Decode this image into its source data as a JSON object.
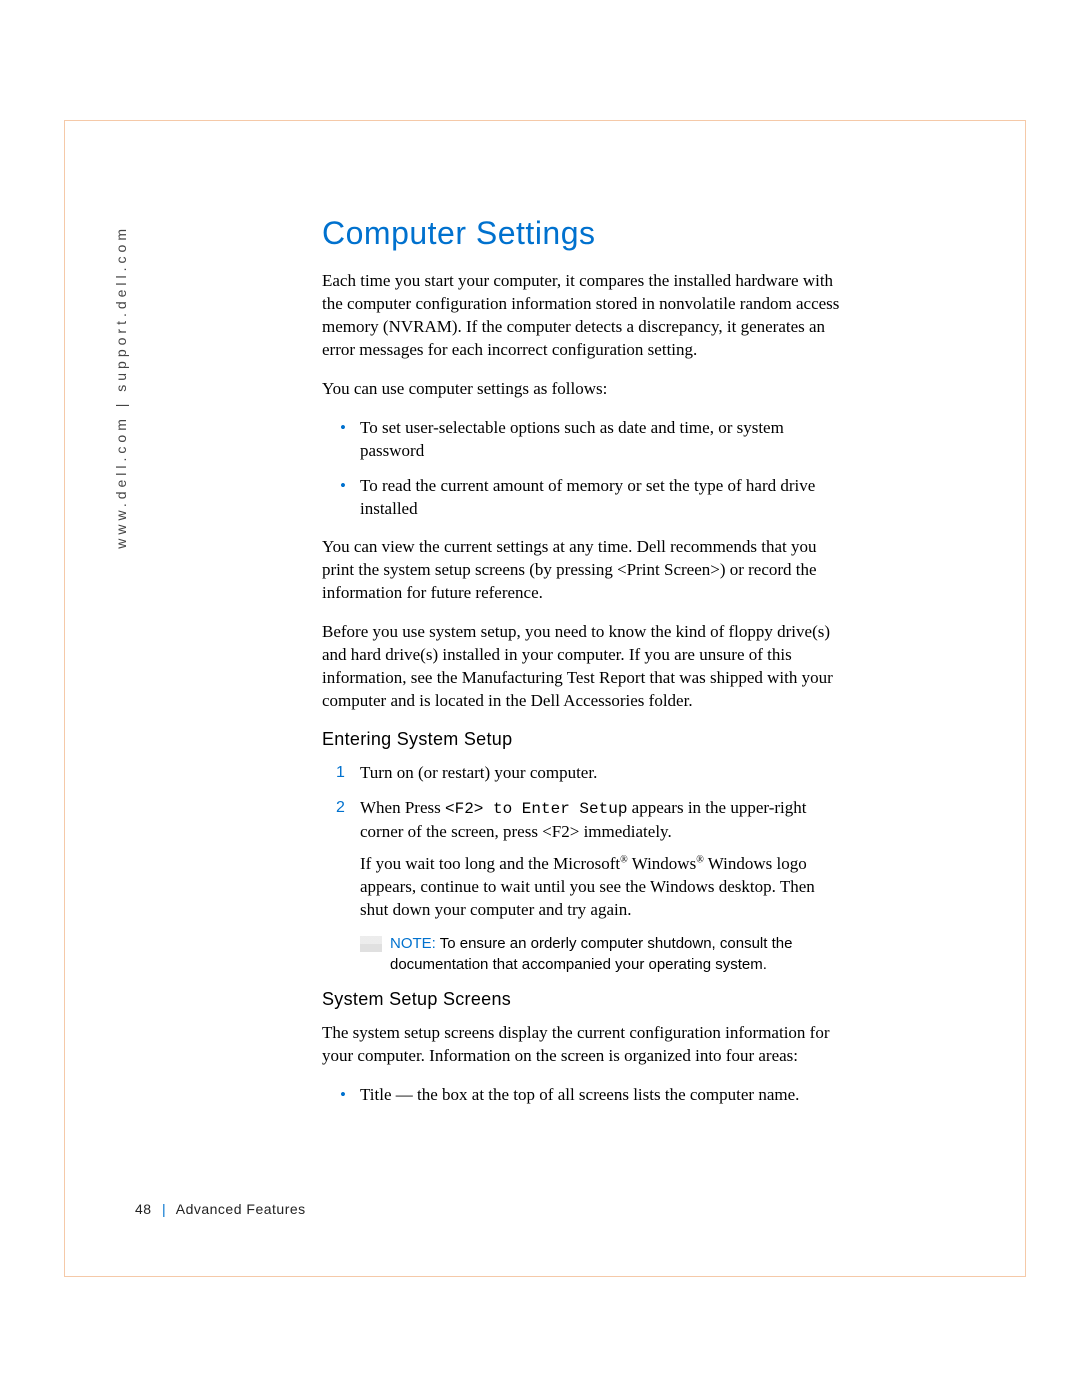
{
  "sidebar": {
    "url_text": "www.dell.com | support.dell.com"
  },
  "heading": "Computer Settings",
  "para1": "Each time you start your computer, it compares the installed hardware with the computer configuration information stored in nonvolatile random access memory (NVRAM). If the computer detects a discrepancy, it generates an error messages for each incorrect configuration setting.",
  "para2": "You can use computer settings as follows:",
  "bullets1": [
    "To set user-selectable options such as date and time, or system password",
    "To read the current amount of memory or set the type of hard drive installed"
  ],
  "para3": "You can view the current settings at any time. Dell recommends that you print the system setup screens (by pressing <Print Screen>) or record the information for future reference.",
  "para4": "Before you use system setup, you need to know the kind of floppy drive(s) and hard drive(s) installed in your computer. If you are unsure of this information, see the Manufacturing Test Report that was shipped with your computer and is located in the Dell Accessories folder.",
  "section1": {
    "title": "Entering System Setup",
    "steps": {
      "n1": "1",
      "s1": "Turn on (or restart) your computer.",
      "n2": "2",
      "s2_a": "When Press ",
      "s2_mono": "<F2> to Enter Setup",
      "s2_b": " appears in the upper-right corner of the screen, press <F2> immediately.",
      "s2_sub_a": "If you wait too long and the Microsoft",
      "s2_sub_b": " Windows",
      "s2_sub_c": " Windows logo appears, continue to wait until you see the Windows desktop. Then shut down your computer and try again.",
      "reg": "®"
    },
    "note_label": "NOTE: ",
    "note_text": "To ensure an orderly computer shutdown, consult the documentation that accompanied your operating system."
  },
  "section2": {
    "title": "System Setup Screens",
    "para": "The system setup screens display the current configuration information for your computer. Information on the screen is organized into four areas:",
    "bullet": "Title — the box at the top of all screens lists the computer name."
  },
  "footer": {
    "page": "48",
    "section": "Advanced Features"
  }
}
